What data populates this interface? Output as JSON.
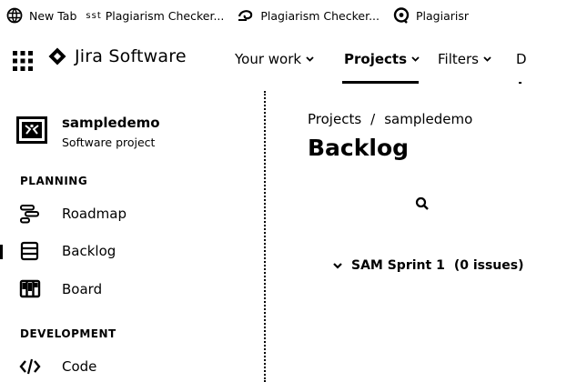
{
  "bookmarks": {
    "new_tab": "New Tab",
    "faint": "sst",
    "items": [
      {
        "label": "Plagiarism Checker...",
        "icon": "plagiarism-checker-icon"
      },
      {
        "label": "Plagiarism Checker...",
        "icon": "swirl-logo-icon"
      },
      {
        "label": "Plagiarisr",
        "icon": "chat-logo-icon"
      }
    ]
  },
  "topnav": {
    "product_name": "Jira Software",
    "items": [
      "Your work",
      "Projects",
      "Filters",
      "D"
    ],
    "active": "Projects"
  },
  "sidebar": {
    "project_name": "sampledemo",
    "project_type": "Software project",
    "planning_heading": "PLANNING",
    "planning_items": [
      {
        "label": "Roadmap",
        "icon": "roadmap-icon"
      },
      {
        "label": "Backlog",
        "icon": "backlog-icon",
        "selected": true
      },
      {
        "label": "Board",
        "icon": "board-icon"
      }
    ],
    "development_heading": "DEVELOPMENT",
    "development_items": [
      {
        "label": "Code",
        "icon": "code-icon"
      }
    ]
  },
  "main": {
    "breadcrumb": {
      "root": "Projects",
      "sep": "/",
      "project": "sampledemo"
    },
    "title": "Backlog",
    "sprint_label": "SAM Sprint 1",
    "sprint_count": "(0 issues)"
  }
}
